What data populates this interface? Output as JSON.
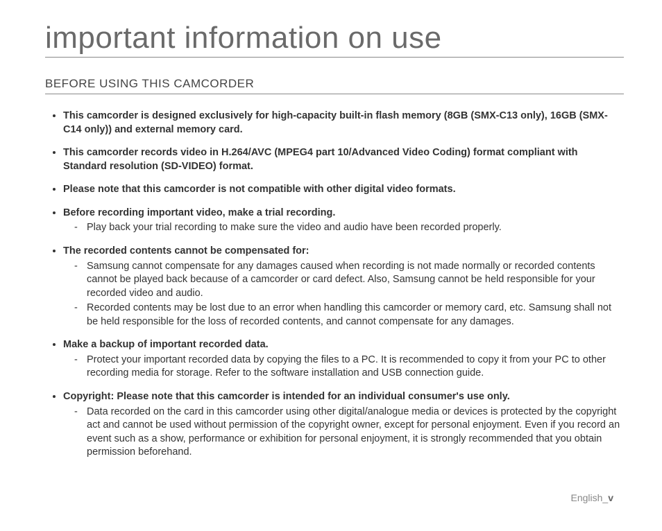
{
  "title": "important information on use",
  "section_heading": "BEFORE USING THIS CAMCORDER",
  "bullets": [
    {
      "bold": "This camcorder is designed exclusively for high-capacity built-in flash memory (8GB (SMX-C13 only), 16GB (SMX-C14 only)) and external memory card.",
      "subs": []
    },
    {
      "bold": "This camcorder records video in H.264/AVC (MPEG4 part 10/Advanced Video Coding) format compliant with Standard resolution (SD-VIDEO) format.",
      "subs": []
    },
    {
      "bold": "Please note that this camcorder is not compatible with other digital video formats.",
      "subs": []
    },
    {
      "bold": "Before recording important video, make a trial recording.",
      "subs": [
        "Play back your trial recording to make sure the video and audio have been recorded properly."
      ]
    },
    {
      "bold": "The recorded contents cannot be compensated for:",
      "subs": [
        "Samsung cannot compensate for any damages caused when recording is not made normally or recorded contents cannot be played back because of a camcorder or card defect. Also, Samsung cannot be held responsible for your recorded video and audio.",
        "Recorded contents may be lost due to an error when handling this camcorder or memory card, etc. Samsung shall not be held responsible for the loss of recorded contents, and cannot compensate for any damages."
      ]
    },
    {
      "bold": "Make a backup of important recorded data.",
      "subs": [
        "Protect your important recorded data by copying the files to a PC. It is recommended to copy it from your PC to other recording media for storage. Refer to the software installation and USB connection guide."
      ]
    },
    {
      "bold": "Copyright: Please note that this camcorder is intended for an individual consumer's use only.",
      "subs": [
        "Data recorded on the card in this camcorder using other digital/analogue media or devices is protected by the copyright act and cannot be used without permission of the copyright owner, except for personal enjoyment. Even if you record an event such as a show, performance or exhibition for personal enjoyment, it is strongly recommended that you obtain permission beforehand."
      ]
    }
  ],
  "footer_lang": "English_",
  "footer_page": "v"
}
